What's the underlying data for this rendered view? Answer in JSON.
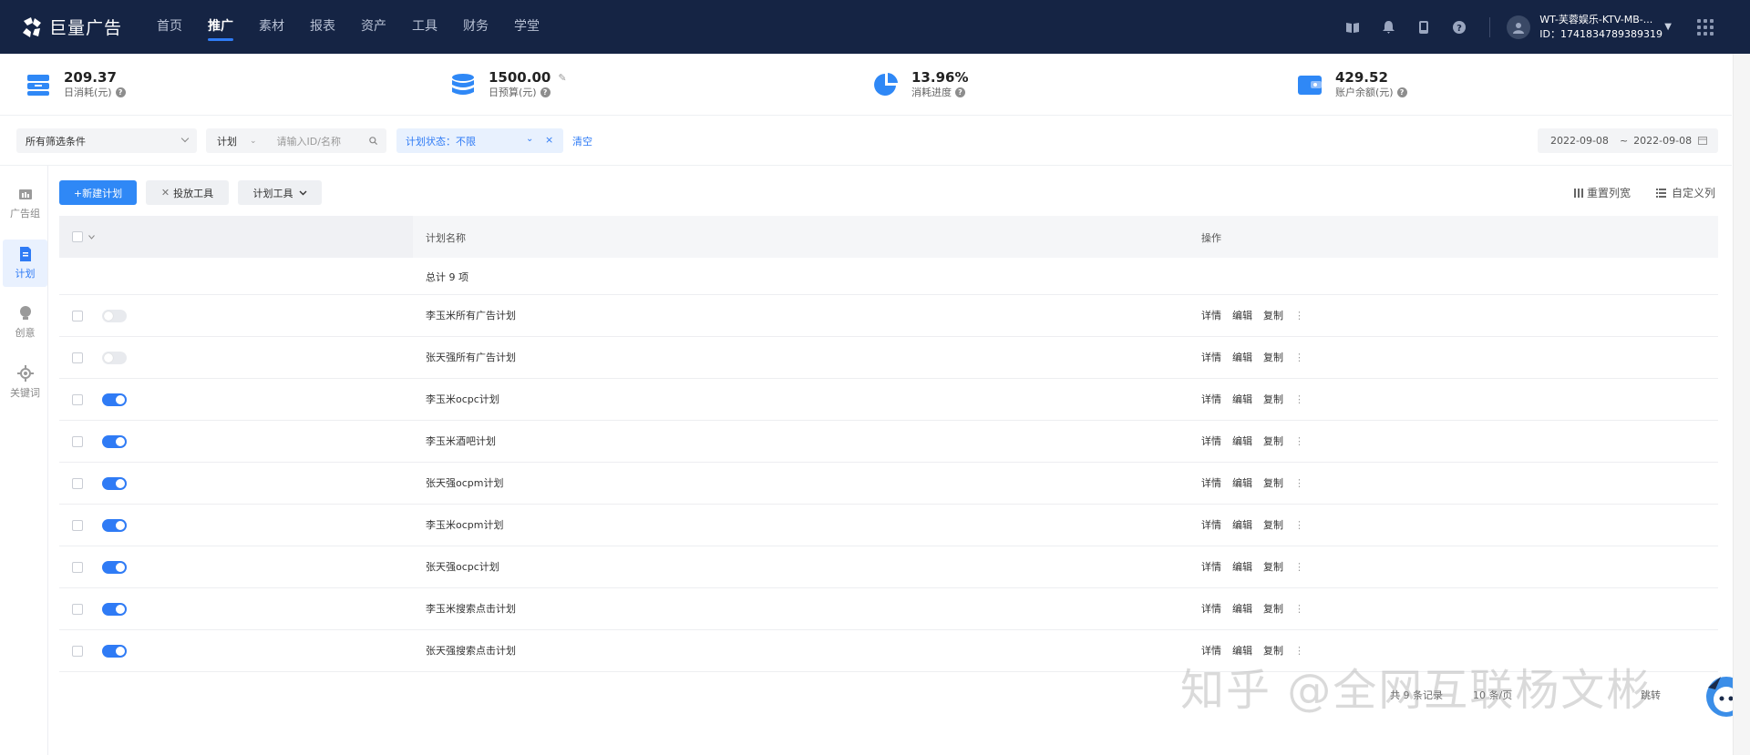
{
  "app": {
    "logo_text": "巨量广告"
  },
  "nav": {
    "items": [
      {
        "label": "首页",
        "active": false
      },
      {
        "label": "推广",
        "active": true
      },
      {
        "label": "素材",
        "active": false
      },
      {
        "label": "报表",
        "active": false
      },
      {
        "label": "资产",
        "active": false
      },
      {
        "label": "工具",
        "active": false
      },
      {
        "label": "财务",
        "active": false
      },
      {
        "label": "学堂",
        "active": false
      }
    ]
  },
  "account": {
    "name": "WT-芙蓉娱乐-KTV-MB-...",
    "id": "ID：1741834789389319"
  },
  "stats": {
    "daily_spend": {
      "value": "209.37",
      "label": "日消耗(元)"
    },
    "daily_budget": {
      "value": "1500.00",
      "label": "日预算(元)"
    },
    "spend_progress": {
      "value": "13.96%",
      "label": "消耗进度"
    },
    "balance": {
      "value": "429.52",
      "label": "账户余额(元)"
    }
  },
  "filters": {
    "all_conditions": "所有筛选条件",
    "scope": "计划",
    "search_placeholder": "请输入ID/名称",
    "status_label": "计划状态：",
    "status_value": "不限",
    "clear": "清空",
    "date_start": "2022-09-08",
    "date_sep": "~",
    "date_end": "2022-09-08"
  },
  "sidebar": {
    "items": [
      {
        "label": "广告组"
      },
      {
        "label": "计划"
      },
      {
        "label": "创意"
      },
      {
        "label": "关键词"
      }
    ]
  },
  "toolbar": {
    "new_plan": "+新建计划",
    "delivery_tool": "投放工具",
    "plan_tool": "计划工具",
    "reset_width": "重置列宽",
    "custom_columns": "自定义列"
  },
  "table": {
    "col_name": "计划名称",
    "col_ops": "操作",
    "total": "总计 9 项",
    "ops": {
      "detail": "详情",
      "edit": "编辑",
      "copy": "复制",
      "more": "⋮"
    },
    "rows": [
      {
        "name": "李玉米所有广告计划",
        "enabled": false
      },
      {
        "name": "张天强所有广告计划",
        "enabled": false
      },
      {
        "name": "李玉米ocpc计划",
        "enabled": true
      },
      {
        "name": "李玉米酒吧计划",
        "enabled": true
      },
      {
        "name": "张天强ocpm计划",
        "enabled": true
      },
      {
        "name": "李玉米ocpm计划",
        "enabled": true
      },
      {
        "name": "张天强ocpc计划",
        "enabled": true
      },
      {
        "name": "李玉米搜索点击计划",
        "enabled": true
      },
      {
        "name": "张天强搜索点击计划",
        "enabled": true
      }
    ]
  },
  "pagination": {
    "total_text": "共 9 条记录",
    "page_size": "10 条/页",
    "jump": "跳转"
  },
  "watermark": "知乎 @全网互联杨文彬",
  "colors": {
    "nav_bg": "#152444",
    "accent": "#2f7bf5"
  }
}
